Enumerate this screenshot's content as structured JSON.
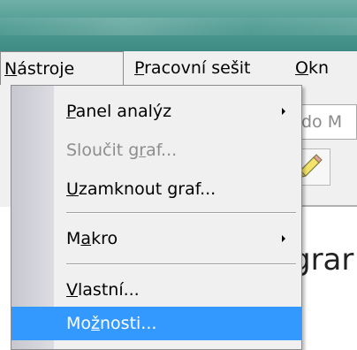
{
  "menubar": {
    "items": [
      {
        "prefix": "",
        "accel": "N",
        "rest": "ástroje"
      },
      {
        "prefix": "",
        "accel": "P",
        "rest": "racovní sešit"
      },
      {
        "prefix": "",
        "accel": "O",
        "rest": "kn"
      }
    ]
  },
  "toolbar": {
    "field_text": "do M"
  },
  "document": {
    "text_fragment": "grar"
  },
  "tools_menu": {
    "items": [
      {
        "prefix": "",
        "accel": "P",
        "rest": "anel analýz",
        "submenu": true,
        "enabled": true
      },
      {
        "prefix": "Sloučit g",
        "accel": "r",
        "rest": "af...",
        "submenu": false,
        "enabled": false
      },
      {
        "prefix": "",
        "accel": "U",
        "rest": "zamknout graf...",
        "submenu": false,
        "enabled": true
      },
      {
        "prefix": "M",
        "accel": "a",
        "rest": "kro",
        "submenu": true,
        "enabled": true
      },
      {
        "prefix": "",
        "accel": "V",
        "rest": "lastní...",
        "submenu": false,
        "enabled": true
      },
      {
        "prefix": "Mo",
        "accel": "ž",
        "rest": "nosti...",
        "submenu": false,
        "enabled": true,
        "selected": true
      }
    ]
  },
  "colors": {
    "selection": "#3399ff",
    "titlebar": "#4d9a91",
    "menu_bg": "#f0f0f0"
  },
  "icons": {
    "toolbar_button": "pencil-icon",
    "submenu": "chevron-right-icon"
  }
}
